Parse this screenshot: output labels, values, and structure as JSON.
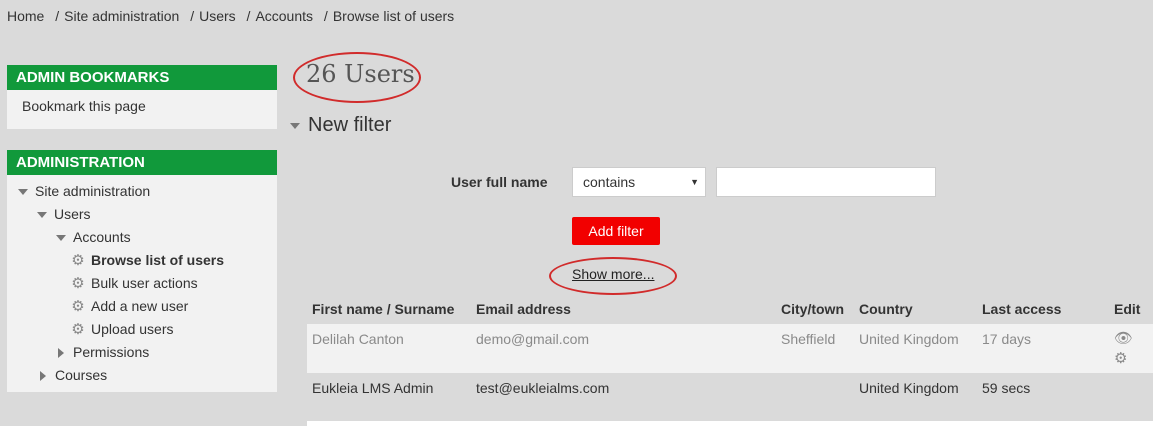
{
  "breadcrumb": [
    "Home",
    "Site administration",
    "Users",
    "Accounts",
    "Browse list of users"
  ],
  "bookmarks": {
    "title": "ADMIN BOOKMARKS",
    "link": "Bookmark this page"
  },
  "administration": {
    "title": "ADMINISTRATION",
    "site_admin": "Site administration",
    "users": "Users",
    "accounts": "Accounts",
    "browse": "Browse list of users",
    "bulk": "Bulk user actions",
    "add_user": "Add a new user",
    "upload": "Upload users",
    "permissions": "Permissions",
    "courses": "Courses"
  },
  "main": {
    "users_count": "26 Users",
    "new_filter": "New filter",
    "filter_label": "User full name",
    "filter_operator": "contains",
    "filter_value": "",
    "add_filter": "Add filter",
    "show_more": "Show more..."
  },
  "table": {
    "headers": [
      "First name / Surname",
      "Email address",
      "City/town",
      "Country",
      "Last access",
      "Edit"
    ],
    "rows": [
      {
        "name": "Delilah Canton",
        "email": "demo@gmail.com",
        "city": "Sheffield",
        "country": "United Kingdom",
        "last_access": "17 days"
      },
      {
        "name": "Eukleia LMS Admin",
        "email": "test@eukleialms.com",
        "city": "",
        "country": "United Kingdom",
        "last_access": "59 secs"
      }
    ]
  },
  "colors": {
    "block_header": "#11993b",
    "add_filter_button": "#f20000",
    "annotation_oval": "#d12b2b"
  }
}
